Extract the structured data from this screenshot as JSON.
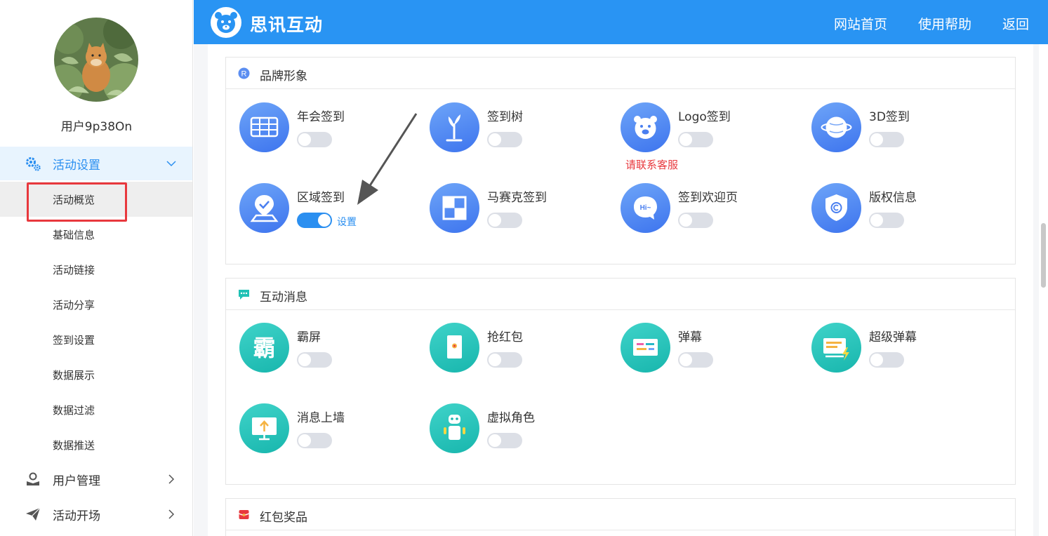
{
  "header": {
    "brand": "思讯互动",
    "nav": [
      "网站首页",
      "使用帮助",
      "返回"
    ]
  },
  "sidebar": {
    "username": "用户9p38On",
    "groups": [
      {
        "label": "活动设置",
        "icon": "gear-icon",
        "expanded": true
      },
      {
        "label": "用户管理",
        "icon": "user-icon",
        "expanded": false
      },
      {
        "label": "活动开场",
        "icon": "paper-plane-icon",
        "expanded": false
      }
    ],
    "sub_items": [
      "活动概览",
      "基础信息",
      "活动链接",
      "活动分享",
      "签到设置",
      "数据展示",
      "数据过滤",
      "数据推送"
    ],
    "active_sub_item": "活动概览"
  },
  "sections": [
    {
      "title": "品牌形象",
      "icon": "r-badge-icon",
      "items": [
        {
          "name": "年会签到",
          "icon": "grid-board-icon",
          "on": false
        },
        {
          "name": "签到树",
          "icon": "tree-icon",
          "on": false
        },
        {
          "name": "Logo签到",
          "icon": "bear-face-icon",
          "on": false,
          "note": "请联系客服"
        },
        {
          "name": "3D签到",
          "icon": "globe-icon",
          "on": false
        },
        {
          "name": "区域签到",
          "icon": "map-pin-icon",
          "on": true,
          "link": "设置"
        },
        {
          "name": "马赛克签到",
          "icon": "mosaic-icon",
          "on": false
        },
        {
          "name": "签到欢迎页",
          "icon": "hi-bubble-icon",
          "on": false
        },
        {
          "name": "版权信息",
          "icon": "copyright-shield-icon",
          "on": false
        }
      ]
    },
    {
      "title": "互动消息",
      "icon": "chat-bubble-icon",
      "items": [
        {
          "name": "霸屏",
          "icon": "ba-character-icon",
          "glyph": "霸",
          "on": false
        },
        {
          "name": "抢红包",
          "icon": "red-envelope-icon",
          "on": false
        },
        {
          "name": "弹幕",
          "icon": "danmaku-screen-icon",
          "on": false
        },
        {
          "name": "超级弹幕",
          "icon": "super-danmaku-icon",
          "on": false
        },
        {
          "name": "消息上墙",
          "icon": "monitor-upload-icon",
          "on": false
        },
        {
          "name": "虚拟角色",
          "icon": "robot-icon",
          "on": false
        }
      ]
    },
    {
      "title": "红包奖品",
      "icon": "gift-icon",
      "items": []
    }
  ],
  "colors": {
    "header_bg": "#2994f3",
    "accent": "#2b8ff0",
    "warning_text": "#e8383d",
    "annotation": "#e8383d"
  }
}
